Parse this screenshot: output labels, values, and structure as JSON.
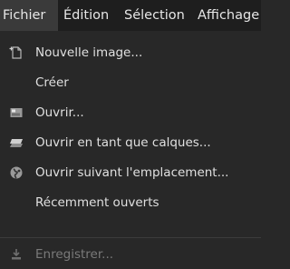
{
  "menubar": {
    "items": [
      {
        "label": "Fichier"
      },
      {
        "label": "Édition"
      },
      {
        "label": "Sélection"
      },
      {
        "label": "Affichage"
      }
    ]
  },
  "file_menu": {
    "items": [
      {
        "label": "Nouvelle image...",
        "icon": "new-image-icon"
      },
      {
        "label": "Créer",
        "icon": ""
      },
      {
        "label": "Ouvrir...",
        "icon": "open-icon"
      },
      {
        "label": "Ouvrir en tant que calques...",
        "icon": "layers-icon"
      },
      {
        "label": "Ouvrir suivant l'emplacement...",
        "icon": "globe-icon"
      },
      {
        "label": "Récemment ouverts",
        "icon": ""
      },
      {
        "label": "Enregistrer...",
        "icon": "save-icon",
        "disabled": true
      }
    ]
  },
  "colors": {
    "menubar_bg": "#1e1e1e",
    "menubar_active_bg": "#3a3a3a",
    "menu_bg": "#282828",
    "text": "#e0e0e0",
    "disabled_text": "#7a7a7a"
  }
}
